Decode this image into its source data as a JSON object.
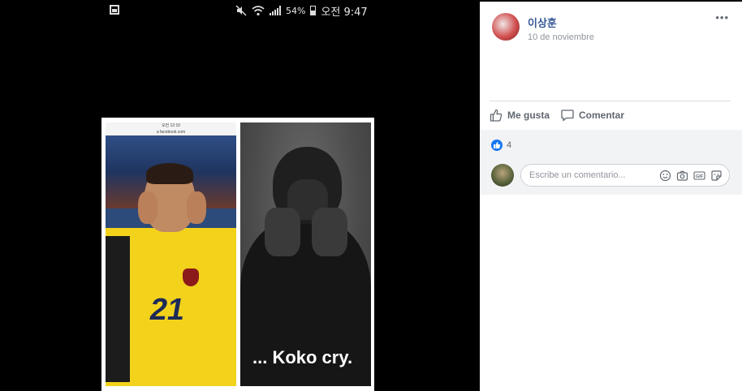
{
  "status_bar": {
    "battery": "54%",
    "time": "오전 9:47",
    "icons": [
      "gallery-icon",
      "mute-icon",
      "wifi-icon",
      "signal-icon",
      "battery-icon"
    ]
  },
  "photo": {
    "mini_status": "오전 12:10",
    "mini_url": "a facebook.com",
    "jersey_number": "21",
    "caption": "... Koko cry."
  },
  "post": {
    "author": "이상훈",
    "date": "10 de noviembre",
    "more_icon": "more-dots-icon",
    "actions": {
      "like_label": "Me gusta",
      "comment_label": "Comentar"
    },
    "reactions": {
      "count": "4",
      "icon": "like-badge-icon"
    },
    "comment_input": {
      "placeholder": "Escribe un comentario...",
      "value": ""
    },
    "comment_icons": [
      "emoji-icon",
      "camera-icon",
      "gif-icon",
      "sticker-icon"
    ]
  },
  "colors": {
    "link": "#385898",
    "muted": "#90949c",
    "like_blue": "#1877f2",
    "panel_gray": "#f2f3f5"
  }
}
